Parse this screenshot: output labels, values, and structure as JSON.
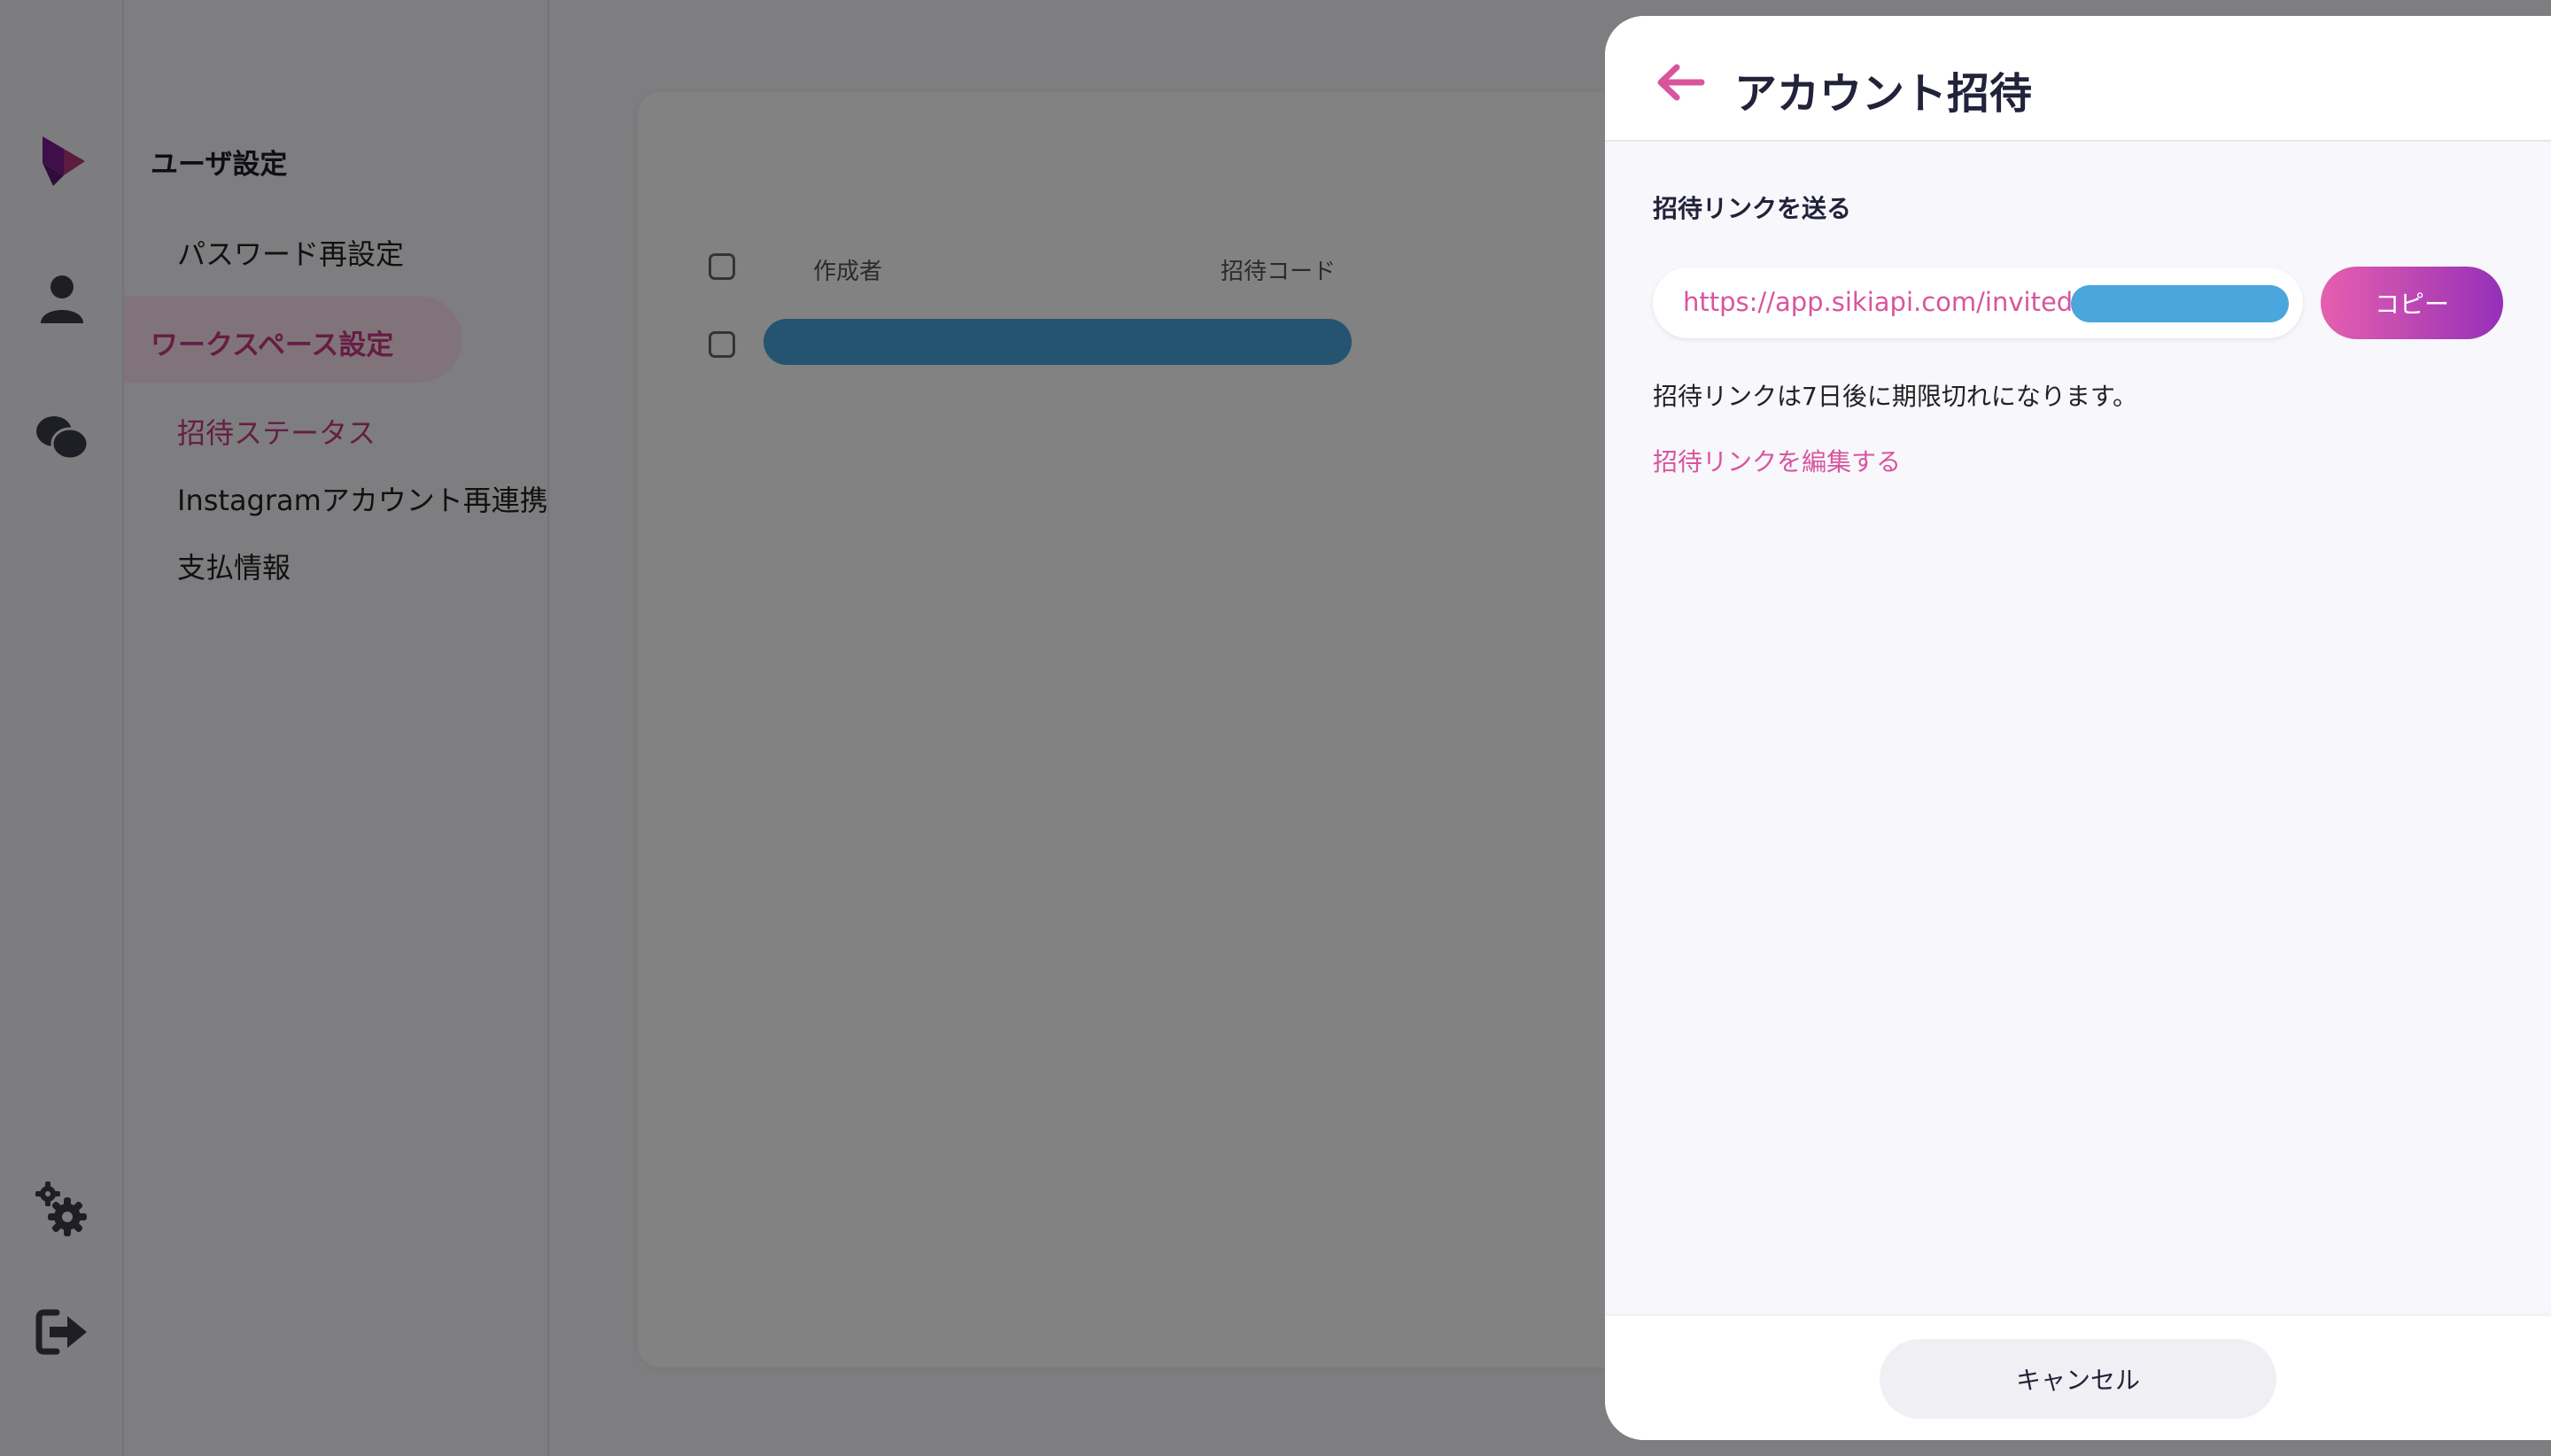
{
  "settings": {
    "user_settings_title": "ユーザ設定",
    "password_reset": "パスワード再設定",
    "workspace_settings_title": "ワークスペース設定",
    "invite_status": "招待ステータス",
    "instagram_relink": "Instagramアカウント再連携",
    "payment_info": "支払情報"
  },
  "table": {
    "col_author": "作成者",
    "col_invite_code": "招待コード"
  },
  "drawer": {
    "title": "アカウント招待",
    "send_link_label": "招待リンクを送る",
    "invite_url": "https://app.sikiapi.com/invited/",
    "copy_label": "コピー",
    "expiry_note": "招待リンクは7日後に期限切れになります。",
    "edit_link": "招待リンクを編集する",
    "cancel_label": "キャンセル"
  },
  "icons": {
    "logo": "logo-icon",
    "user": "user-icon",
    "chat": "chat-icon",
    "gear": "gear-icon",
    "logout": "logout-icon",
    "back": "arrow-left-icon"
  },
  "colors": {
    "accent": "#d8559d",
    "redaction": "#4aa6dc",
    "copy_gradient_start": "#e65fae",
    "copy_gradient_end": "#9530b8"
  }
}
